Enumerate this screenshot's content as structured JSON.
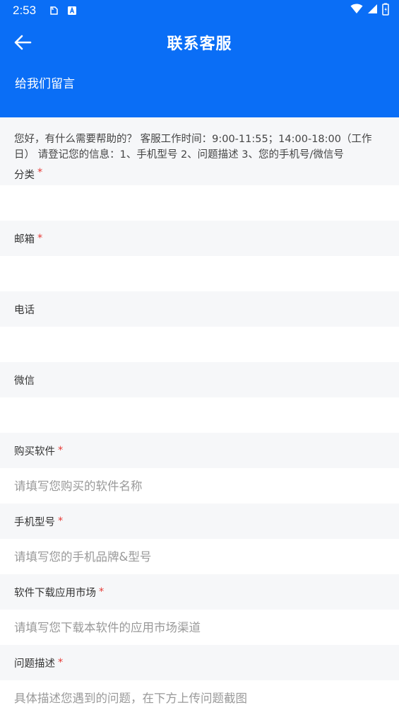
{
  "status_bar": {
    "time": "2:53"
  },
  "header": {
    "title": "联系客服",
    "subtitle": "给我们留言"
  },
  "notice": "您好，有什么需要帮助的？ 客服工作时间：9:00-11:55；14:00-18:00（工作日） 请登记您的信息：1、手机型号 2、问题描述 3、您的手机号/微信号",
  "fields": [
    {
      "label": "分类",
      "required": "*",
      "placeholder": ""
    },
    {
      "label": "邮箱",
      "required": "*",
      "placeholder": ""
    },
    {
      "label": "电话",
      "required": "",
      "placeholder": ""
    },
    {
      "label": "微信",
      "required": "",
      "placeholder": ""
    },
    {
      "label": "购买软件",
      "required": "*",
      "placeholder": "请填写您购买的软件名称"
    },
    {
      "label": "手机型号",
      "required": "*",
      "placeholder": "请填写您的手机品牌&型号"
    },
    {
      "label": "软件下载应用市场",
      "required": "*",
      "placeholder": "请填写您下载本软件的应用市场渠道"
    },
    {
      "label": "问题描述",
      "required": "*",
      "placeholder": "具体描述您遇到的问题，在下方上传问题截图"
    }
  ],
  "colors": {
    "primary": "#0a6ef6",
    "required": "#e53935",
    "background": "#f6f7f9"
  }
}
